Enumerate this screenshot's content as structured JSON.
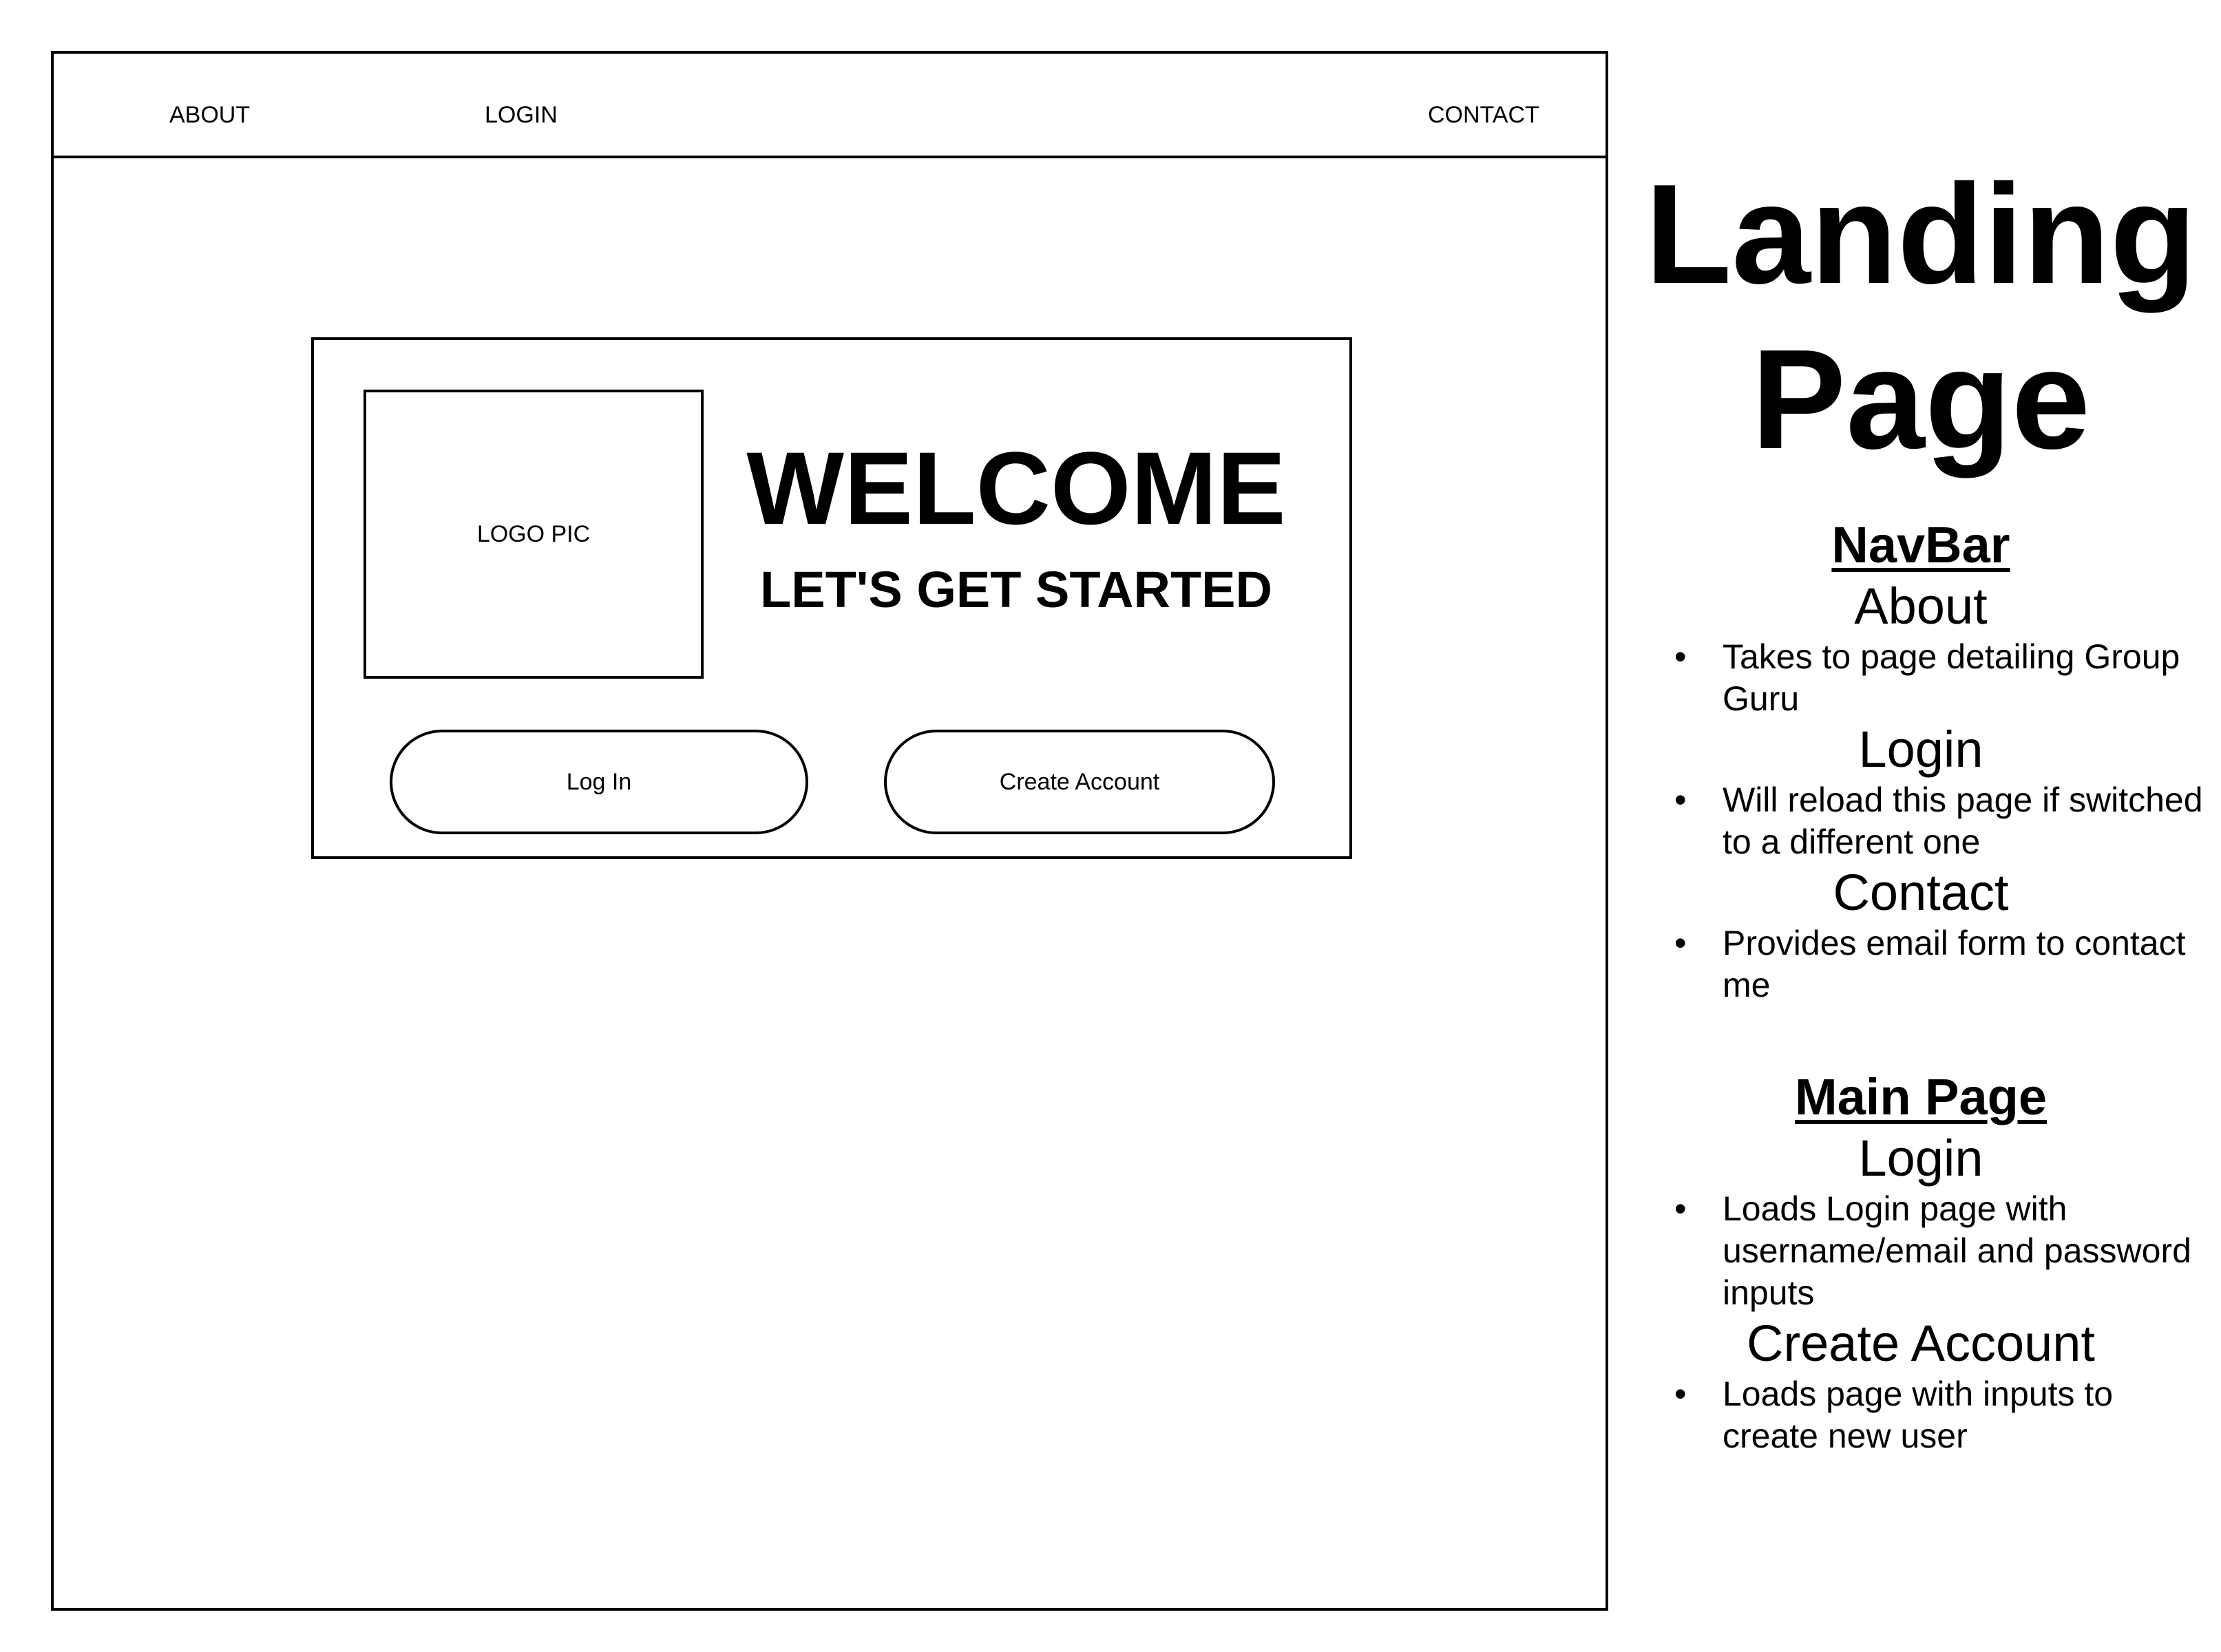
{
  "wireframe": {
    "nav": {
      "about": "ABOUT",
      "login": "LOGIN",
      "contact": "CONTACT"
    },
    "card": {
      "logo_label": "LOGO PIC",
      "title": "WELCOME",
      "subtitle": "LET'S GET STARTED",
      "login_button": "Log In",
      "create_button": "Create Account"
    }
  },
  "notes": {
    "title_line1": "Landing",
    "title_line2": "Page",
    "navbar": {
      "heading": "NavBar",
      "items": [
        {
          "name": "About",
          "bullet": "Takes to page detailing Group Guru"
        },
        {
          "name": "Login",
          "bullet": "Will reload this page if switched to a different one"
        },
        {
          "name": "Contact",
          "bullet": "Provides email form to contact me"
        }
      ]
    },
    "main": {
      "heading": "Main Page",
      "items": [
        {
          "name": "Login",
          "bullet": "Loads Login page with username/email and password inputs"
        },
        {
          "name": "Create Account",
          "bullet": "Loads page with inputs to create new user"
        }
      ]
    }
  }
}
